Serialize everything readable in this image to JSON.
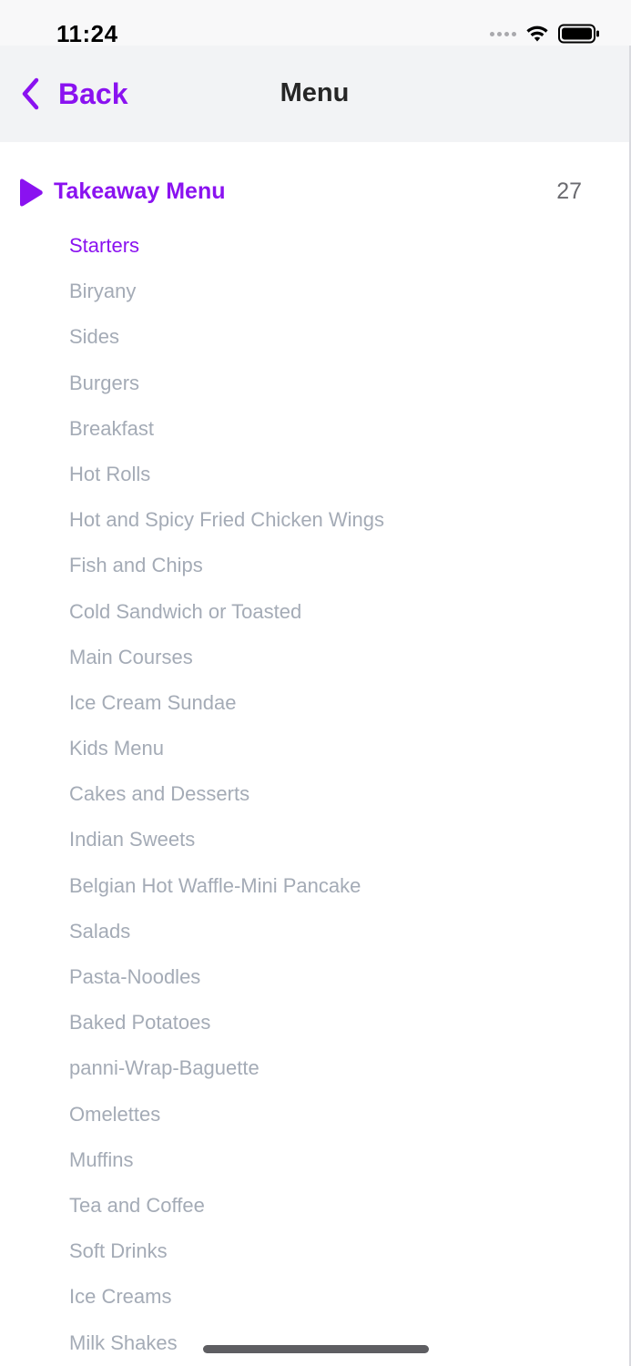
{
  "status_bar": {
    "time": "11:24",
    "icons": [
      "signal-dots-icon",
      "wifi-icon",
      "battery-icon"
    ]
  },
  "nav": {
    "back_label": "Back",
    "title": "Menu"
  },
  "menu": {
    "name": "Takeaway Menu",
    "count": "27",
    "categories": [
      "Starters",
      "Biryany",
      "Sides",
      "Burgers",
      "Breakfast",
      "Hot Rolls",
      "Hot and Spicy Fried Chicken Wings",
      "Fish and Chips",
      "Cold Sandwich or Toasted",
      "Main Courses",
      "Ice Cream Sundae",
      "Kids Menu",
      "Cakes and Desserts",
      "Indian Sweets",
      "Belgian Hot Waffle-Mini Pancake",
      "Salads",
      "Pasta-Noodles",
      "Baked Potatoes",
      "panni-Wrap-Baguette",
      "Omelettes",
      "Muffins",
      "Tea and Coffee",
      "Soft Drinks",
      "Ice Creams",
      "Milk Shakes"
    ],
    "active_category": "Starters"
  },
  "colors": {
    "accent": "#8a12f0",
    "category_text": "#a4abb6",
    "nav_background": "#f2f3f5"
  }
}
